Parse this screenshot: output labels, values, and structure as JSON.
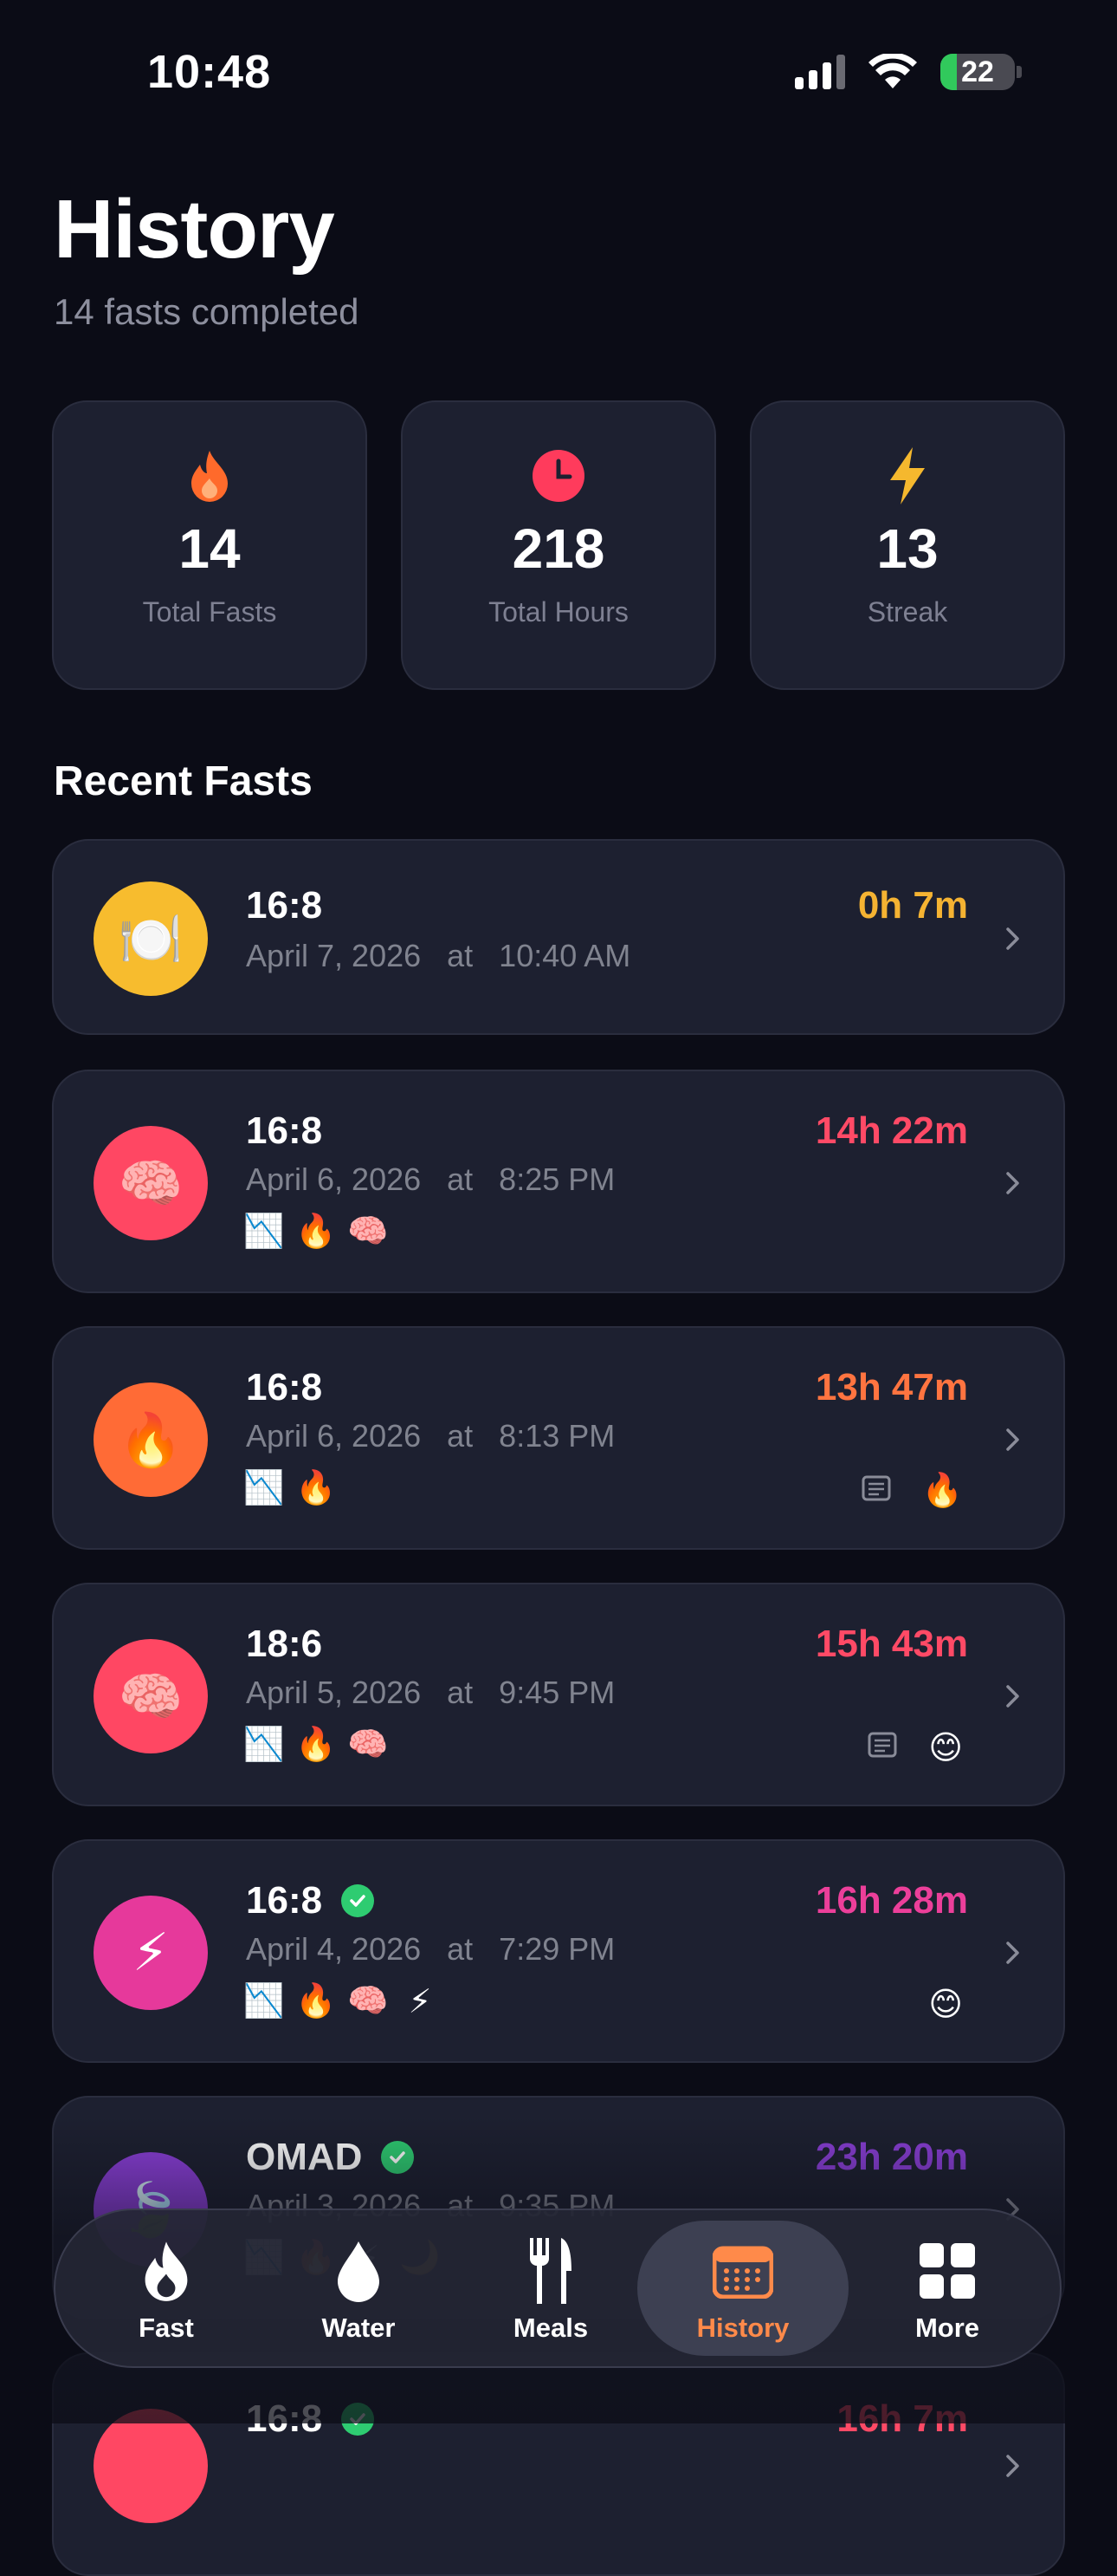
{
  "status_bar": {
    "time": "10:48",
    "battery": "22",
    "battery_level": 0.22
  },
  "header": {
    "title": "History",
    "subtitle": "14 fasts completed"
  },
  "stats": [
    {
      "icon": "flame-icon",
      "value": "14",
      "label": "Total Fasts",
      "color": "#ff6a2b"
    },
    {
      "icon": "clock-icon",
      "value": "218",
      "label": "Total Hours",
      "color": "#ff3b5c"
    },
    {
      "icon": "bolt-icon",
      "value": "13",
      "label": "Streak",
      "color": "#f5b82e"
    }
  ],
  "section_title": "Recent Fasts",
  "fasts": [
    {
      "plan": "16:8",
      "date": "April 7, 2026   at   10:40 AM",
      "duration": "0h 7m",
      "duration_color": "#f5b332",
      "avatar_icon": "plate-icon",
      "avatar_emoji": "🍽️",
      "avatar_color": "#f7bc2e",
      "completed": false,
      "tags": [],
      "extras": []
    },
    {
      "plan": "16:8",
      "date": "April 6, 2026   at   8:25 PM",
      "duration": "14h 22m",
      "duration_color": "#ff4a66",
      "avatar_icon": "brain-icon",
      "avatar_emoji": "🧠",
      "avatar_color": "#ff4763",
      "completed": false,
      "tags": [
        "📉",
        "🔥",
        "🧠"
      ],
      "extras": []
    },
    {
      "plan": "16:8",
      "date": "April 6, 2026   at   8:13 PM",
      "duration": "13h 47m",
      "duration_color": "#ff7440",
      "avatar_icon": "flame-icon",
      "avatar_emoji": "🔥",
      "avatar_color": "#ff6b36",
      "completed": false,
      "tags": [
        "📉",
        "🔥"
      ],
      "extras": [
        "note",
        "🔥"
      ]
    },
    {
      "plan": "18:6",
      "date": "April 5, 2026   at   9:45 PM",
      "duration": "15h 43m",
      "duration_color": "#ff4a66",
      "avatar_icon": "brain-icon",
      "avatar_emoji": "🧠",
      "avatar_color": "#ff4763",
      "completed": false,
      "tags": [
        "📉",
        "🔥",
        "🧠"
      ],
      "extras": [
        "note",
        "😊"
      ]
    },
    {
      "plan": "16:8",
      "date": "April 4, 2026   at   7:29 PM",
      "duration": "16h 28m",
      "duration_color": "#ec3f9a",
      "avatar_icon": "bolt-icon",
      "avatar_emoji": "⚡",
      "avatar_color": "#e6399b",
      "completed": true,
      "tags": [
        "📉",
        "🔥",
        "🧠",
        "⚡"
      ],
      "extras": [
        "😊"
      ]
    },
    {
      "plan": "OMAD",
      "date": "April 3, 2026   at   9:35 PM",
      "duration": "23h 20m",
      "duration_color": "#8a3fd6",
      "avatar_icon": "leaf-icon",
      "avatar_emoji": "🍃",
      "avatar_color": "#8b3fd8",
      "completed": true,
      "tags": [
        "📉",
        "🔥",
        "⚡",
        "🌙"
      ],
      "extras": []
    },
    {
      "plan": "16:8",
      "date": "",
      "duration": "16h 7m",
      "duration_color": "#ff4a66",
      "avatar_icon": "brain-icon",
      "avatar_emoji": "",
      "avatar_color": "#ff4763",
      "completed": true,
      "tags": [],
      "extras": []
    }
  ],
  "tabs": [
    {
      "label": "Fast",
      "icon": "flame-icon",
      "active": false
    },
    {
      "label": "Water",
      "icon": "droplet-icon",
      "active": false
    },
    {
      "label": "Meals",
      "icon": "fork-knife-icon",
      "active": false
    },
    {
      "label": "History",
      "icon": "calendar-icon",
      "active": true
    },
    {
      "label": "More",
      "icon": "grid-icon",
      "active": false
    }
  ],
  "colors": {
    "background": "#0b0c16",
    "card": "#1d2030",
    "accent": "#ff8a4a"
  }
}
